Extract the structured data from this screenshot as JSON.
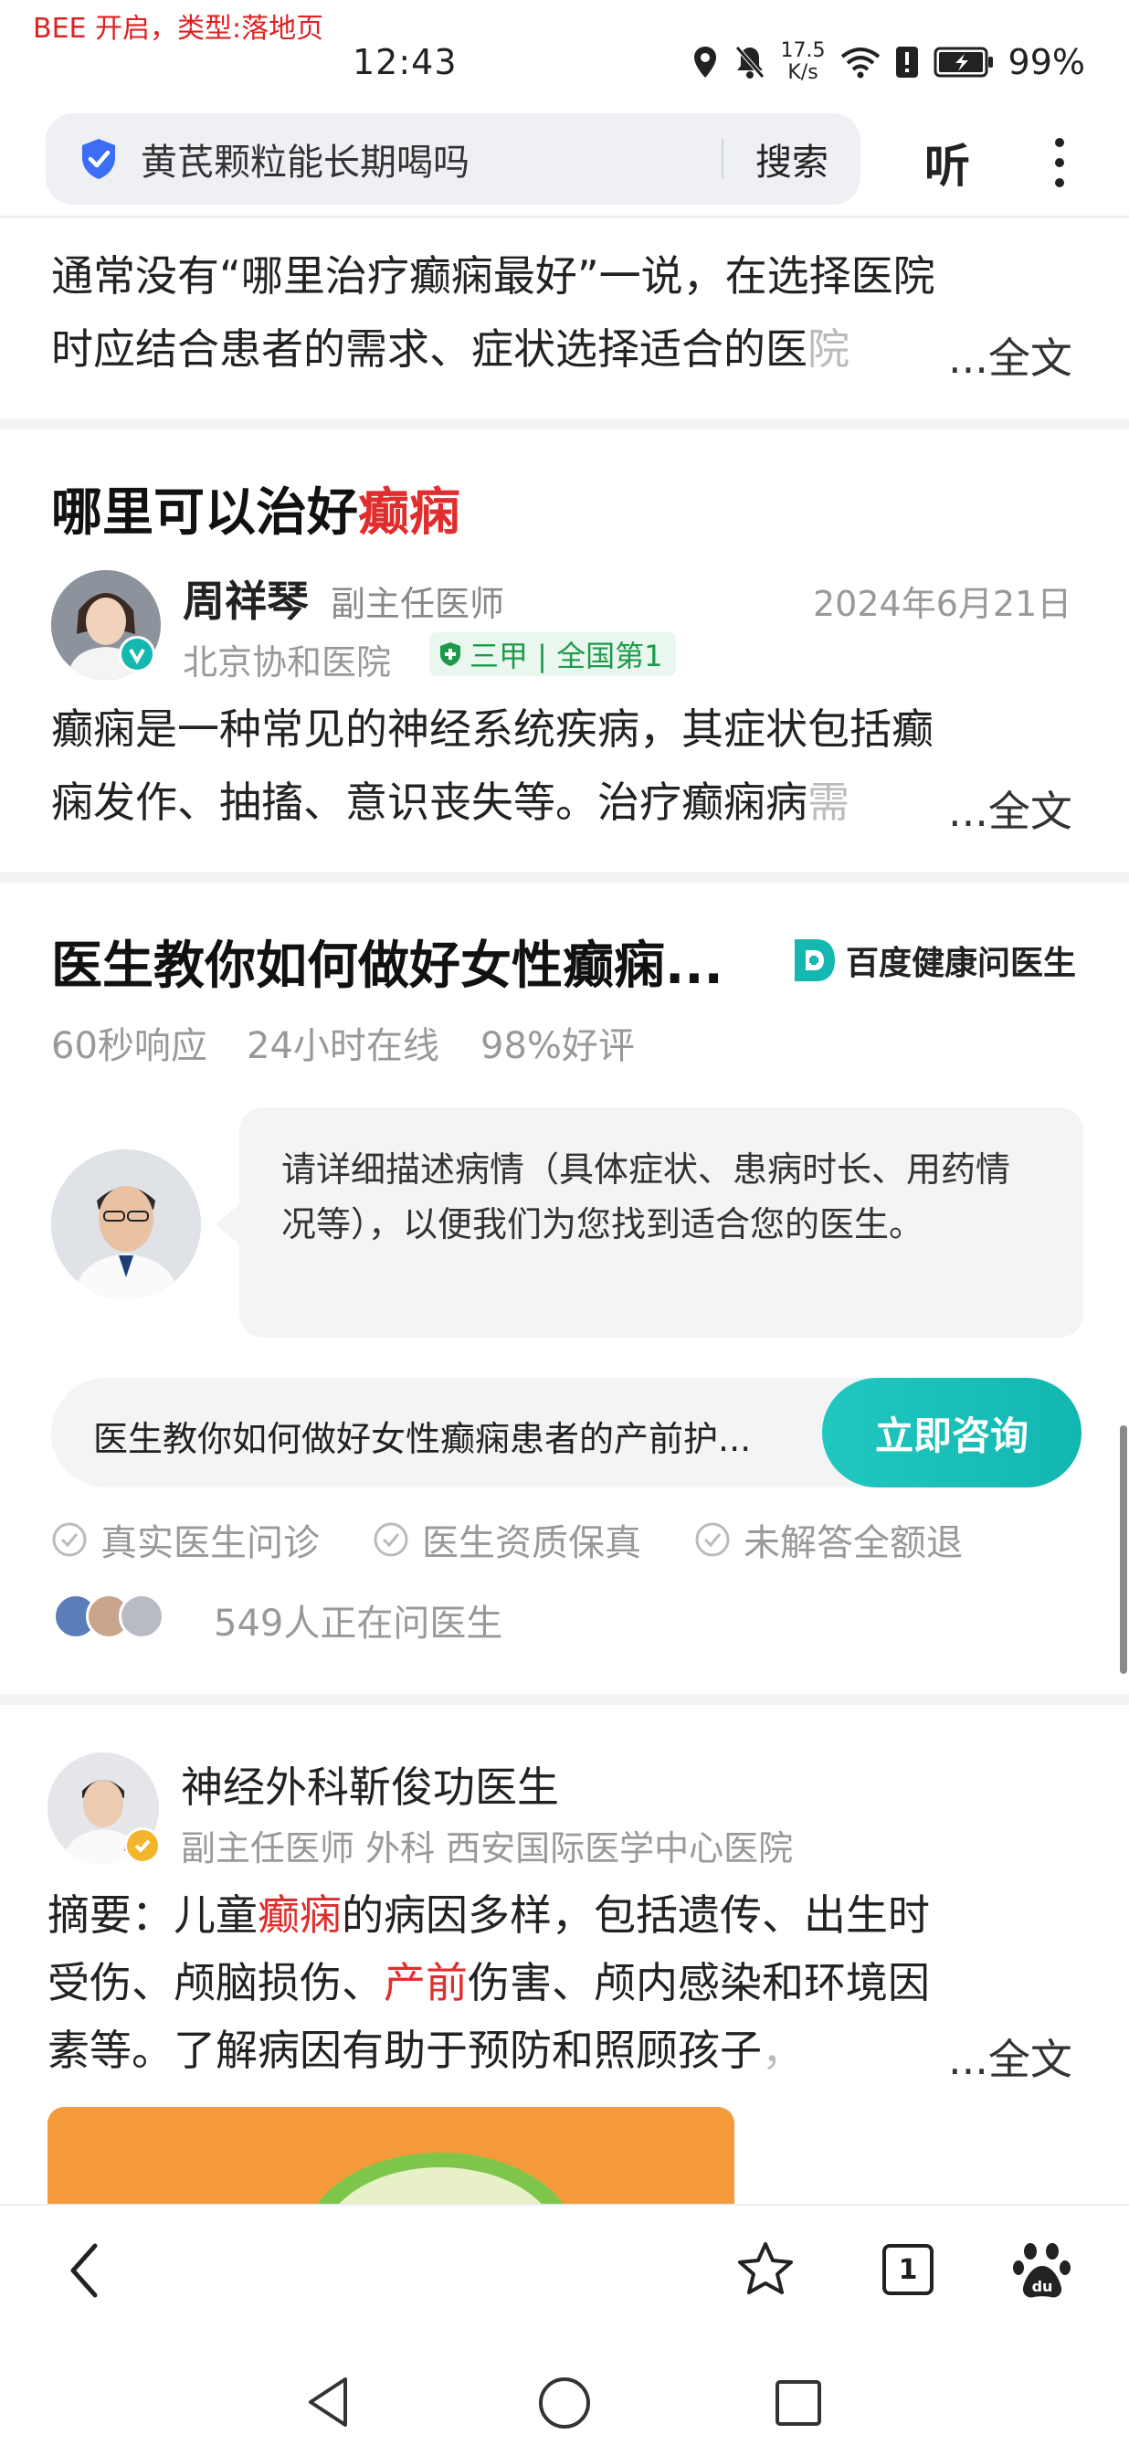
{
  "debug_label": "BEE 开启，类型:落地页",
  "status_bar": {
    "time": "12:43",
    "net_speed_value": "17.5",
    "net_speed_unit": "K/s",
    "battery": "99%"
  },
  "search": {
    "query": "黄芪颗粒能长期喝吗",
    "search_label": "搜索",
    "listen_label": "听"
  },
  "card1": {
    "line1": "通常没有“哪里治疗癫痫最好”一说，在选择医院",
    "line2": "时应结合患者的需求、症状选择适合的医",
    "line2_tail": "院",
    "more": "...全文"
  },
  "card2": {
    "title_prefix": "哪里可以治好",
    "title_highlight": "癫痫",
    "doctor_name": "周祥琴",
    "doctor_title": "副主任医师",
    "date": "2024年6月21日",
    "hospital": "北京协和医院",
    "tag": "三甲 | 全国第1",
    "line1": "癫痫是一种常见的神经系统疾病，其症状包括癫",
    "line2": "痫发作、抽搐、意识丧失等。治疗癫痫病",
    "line2_tail": "需",
    "more": "...全文"
  },
  "ad_card": {
    "title": "医生教你如何做好女性癫痫...",
    "brand": "百度健康问医生",
    "stats": [
      "60秒响应",
      "24小时在线",
      "98%好评"
    ],
    "bubble_text": "请详细描述病情（具体症状、患病时长、用药情况等），以便我们为您找到适合您的医生。",
    "input_text": "医生教你如何做好女性癫痫患者的产前护...",
    "consult_button": "立即咨询",
    "guarantees": [
      "真实医生问诊",
      "医生资质保真",
      "未解答全额退"
    ],
    "asking_count": "549人正在问医生"
  },
  "article": {
    "author": "神经外科靳俊功医生",
    "meta": "副主任医师 外科 西安国际医学中心医院",
    "line1_a": "摘要：儿童",
    "line1_hl": "癫痫",
    "line1_b": "的病因多样，包括遗传、出生时",
    "line2_a": "受伤、颅脑损伤、",
    "line2_hl": "产前",
    "line2_b": "伤害、颅内感染和环境因",
    "line3": "素等。了解病因有助于预防和照顾孩子",
    "line3_tail": "，",
    "more": "...全文"
  },
  "toolbar": {
    "tab_count": "1"
  },
  "colors": {
    "accent_red": "#e02d2d",
    "consult_teal": "#14bab3",
    "tag_green": "#1d9a4b"
  }
}
